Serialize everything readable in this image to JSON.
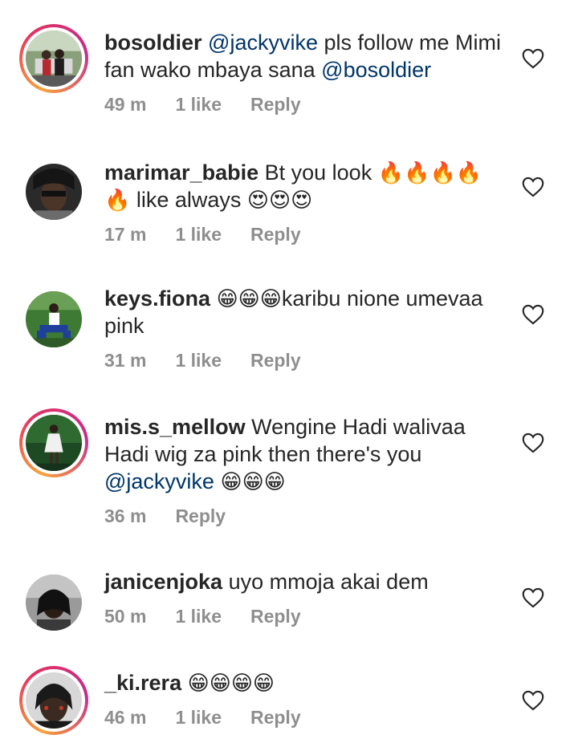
{
  "comments": [
    {
      "username": "bosoldier",
      "parts": [
        {
          "type": "mention",
          "text": "@jackyvike"
        },
        {
          "type": "text",
          "text": " pls follow me Mimi fan wako mbaya sana "
        },
        {
          "type": "mention",
          "text": "@bosoldier"
        }
      ],
      "time": "49 m",
      "likes": "1 like",
      "reply": "Reply"
    },
    {
      "username": "marimar_babie",
      "parts": [
        {
          "type": "text",
          "text": "Bt you look "
        },
        {
          "type": "emoji",
          "text": "🔥🔥🔥🔥🔥"
        },
        {
          "type": "text",
          "text": " like always "
        },
        {
          "type": "emoji",
          "text": "😍😍😍"
        }
      ],
      "time": "17 m",
      "likes": "1 like",
      "reply": "Reply"
    },
    {
      "username": "keys.fiona",
      "parts": [
        {
          "type": "emoji",
          "text": "😁😁😁"
        },
        {
          "type": "text",
          "text": "karibu nione umevaa pink"
        }
      ],
      "time": "31 m",
      "likes": "1 like",
      "reply": "Reply"
    },
    {
      "username": "mis.s_mellow",
      "parts": [
        {
          "type": "text",
          "text": "Wengine Hadi walivaa Hadi wig za pink then there's you "
        },
        {
          "type": "mention",
          "text": "@jackyvike"
        },
        {
          "type": "text",
          "text": " "
        },
        {
          "type": "emoji",
          "text": "😁😁😁"
        }
      ],
      "time": "36 m",
      "likes": "",
      "reply": "Reply"
    },
    {
      "username": "janicenjoka",
      "parts": [
        {
          "type": "text",
          "text": "uyo mmoja akai dem"
        }
      ],
      "time": "50 m",
      "likes": "1 like",
      "reply": "Reply"
    },
    {
      "username": "_ki.rera",
      "parts": [
        {
          "type": "emoji",
          "text": "😁😁😁😁"
        }
      ],
      "time": "46 m",
      "likes": "1 like",
      "reply": "Reply"
    }
  ],
  "colors": {
    "mention": "#003569",
    "muted": "#8e8e8e",
    "text": "#262626"
  },
  "icons": {
    "like": "heart-outline-icon"
  }
}
